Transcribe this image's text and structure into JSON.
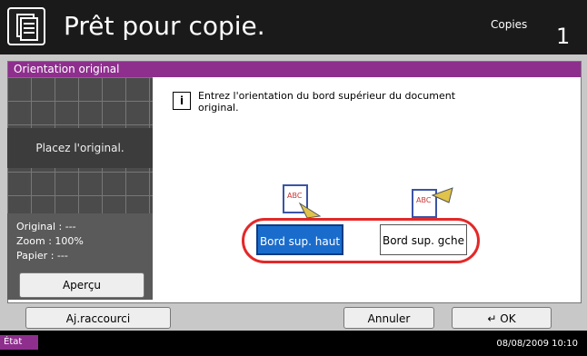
{
  "header": {
    "title": "Prêt pour copie.",
    "copies_label": "Copies",
    "copies_value": "1"
  },
  "panel": {
    "title": "Orientation original",
    "info": "Entrez l'orientation du bord supérieur du document original.",
    "options": [
      {
        "label": "Bord sup. haut",
        "selected": true
      },
      {
        "label": "Bord sup. gche",
        "selected": false
      }
    ]
  },
  "preview": {
    "placeholder": "Placez l'original.",
    "original": "Original : ---",
    "zoom": "Zoom : 100%",
    "paper": "Papier : ---",
    "apercu": "Aperçu"
  },
  "buttons": {
    "shortcut": "Aj.raccourci",
    "cancel": "Annuler",
    "ok": "OK"
  },
  "status": {
    "label": "État",
    "datetime": "08/08/2009 10:10"
  },
  "colors": {
    "accent": "#8e2f8e",
    "selected": "#1a6ccc",
    "highlight": "#e32828"
  }
}
